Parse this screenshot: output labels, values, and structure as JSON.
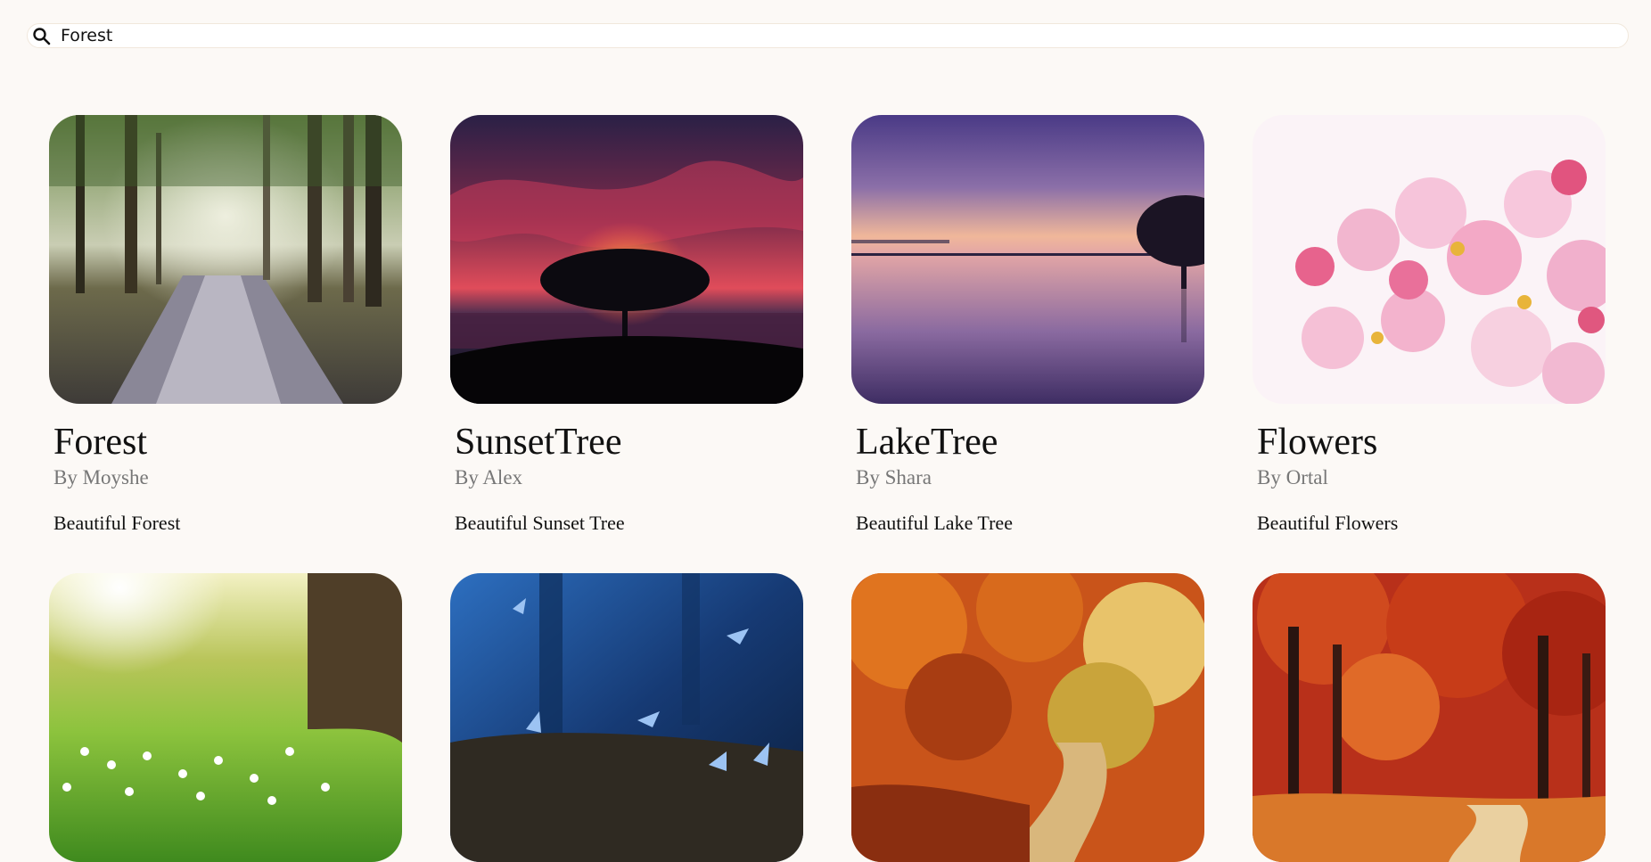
{
  "search": {
    "value": "Forest",
    "icon": "search-icon"
  },
  "cards": [
    {
      "title": "Forest",
      "author": "By Moyshe",
      "description": "Beautiful Forest",
      "image": "forest-path-image"
    },
    {
      "title": "SunsetTree",
      "author": "By Alex",
      "description": "Beautiful Sunset Tree",
      "image": "sunset-tree-image"
    },
    {
      "title": "LakeTree",
      "author": "By Shara",
      "description": "Beautiful Lake Tree",
      "image": "lake-tree-image"
    },
    {
      "title": "Flowers",
      "author": "By Ortal",
      "description": "Beautiful Flowers",
      "image": "cherry-blossom-image"
    },
    {
      "image": "meadow-tree-image"
    },
    {
      "image": "blue-butterflies-image"
    },
    {
      "image": "autumn-road-image"
    },
    {
      "image": "red-autumn-forest-image"
    }
  ],
  "colors": {
    "background": "#fcf9f6",
    "title": "#111111",
    "author": "#777777"
  }
}
